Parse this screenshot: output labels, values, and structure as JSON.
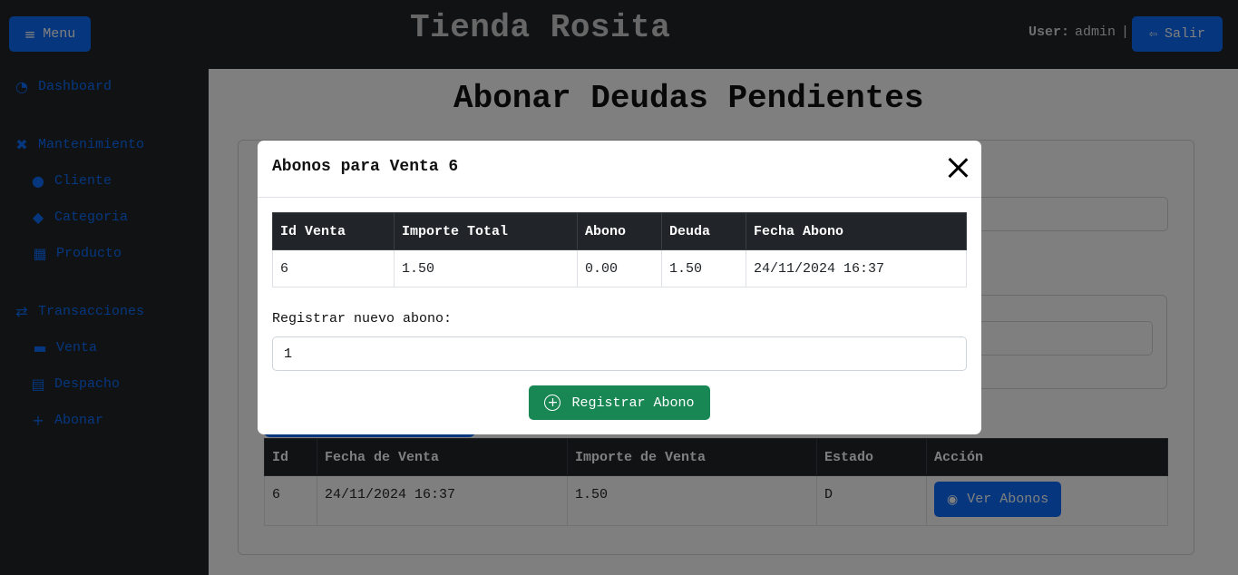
{
  "header": {
    "menu_label": "Menu",
    "menu_icon": "≡",
    "title": "Tienda Rosita",
    "user_label": "User:",
    "user_name": "admin",
    "separator": "|",
    "logout_label": "Salir",
    "logout_icon": "⇦"
  },
  "sidebar": {
    "dashboard": {
      "label": "Dashboard",
      "icon": "◔"
    },
    "mantenimiento": {
      "label": "Mantenimiento",
      "icon": "✖"
    },
    "cliente": {
      "label": "Cliente",
      "icon": "●"
    },
    "categoria": {
      "label": "Categoria",
      "icon": "◆"
    },
    "producto": {
      "label": "Producto",
      "icon": "▦"
    },
    "transacciones": {
      "label": "Transacciones",
      "icon": "⇄"
    },
    "venta": {
      "label": "Venta",
      "icon": "▬"
    },
    "despacho": {
      "label": "Despacho",
      "icon": "▤"
    },
    "abonar": {
      "label": "Abonar",
      "icon": "+"
    }
  },
  "main": {
    "page_title": "Abonar Deudas Pendientes",
    "table": {
      "headers": [
        "Id",
        "Fecha de Venta",
        "Importe de Venta",
        "Estado",
        "Acción"
      ],
      "rows": [
        {
          "id": "6",
          "fecha": "24/11/2024 16:37",
          "importe": "1.50",
          "estado": "D",
          "action_label": "Ver Abonos",
          "action_icon": "◉"
        }
      ]
    }
  },
  "modal": {
    "title": "Abonos para Venta 6",
    "table": {
      "headers": [
        "Id Venta",
        "Importe Total",
        "Abono",
        "Deuda",
        "Fecha Abono"
      ],
      "rows": [
        {
          "id_venta": "6",
          "importe_total": "1.50",
          "abono": "0.00",
          "deuda": "1.50",
          "fecha_abono": "24/11/2024 16:37"
        }
      ]
    },
    "new_label": "Registrar nuevo abono:",
    "new_value": "1",
    "submit_label": "Registrar Abono",
    "submit_icon": "+"
  },
  "colors": {
    "primary": "#0d6efd",
    "success": "#198754",
    "dark": "#212529"
  }
}
